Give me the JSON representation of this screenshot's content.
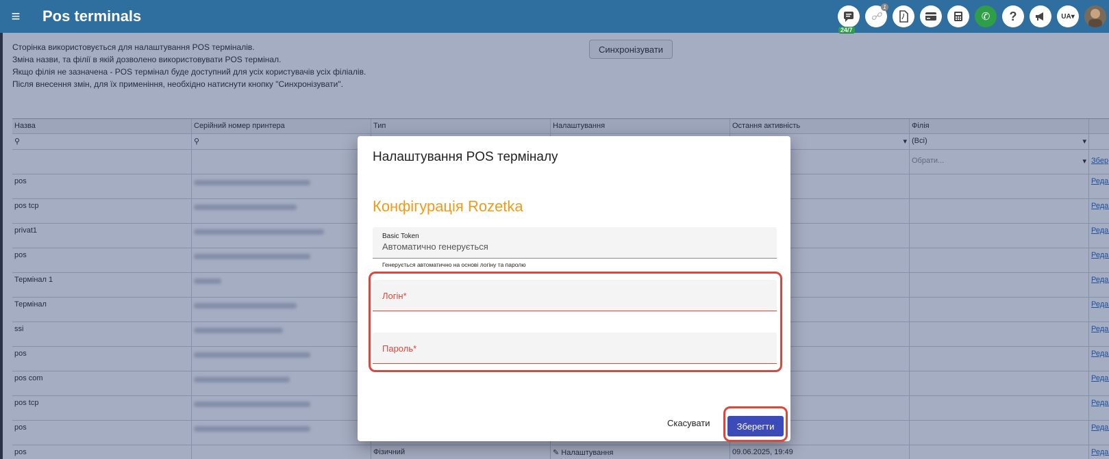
{
  "header": {
    "menu_icon": "hamburger-icon",
    "title": "Pos terminals",
    "support_badge": "24/7",
    "notif_count": "1",
    "lang": "UA▾"
  },
  "info": {
    "lines": [
      "Сторінка використовується для налаштування POS терміналів.",
      "Зміна назви, та філії в якій дозволено використовувати POS термінал.",
      "Якщо філія не зазначена - POS термінал буде доступний для усіх користувачів усіх філіалів.",
      "Після внесення змін, для їх применіння, необхідно натиснути кнопку \"Синхронізувати\"."
    ],
    "sync_button": "Синхронізувати"
  },
  "grid": {
    "columns": [
      "Назва",
      "Серійний номер принтера",
      "Тип",
      "Налаштування",
      "Остання активність",
      "Філія",
      ""
    ],
    "filter_branch": "(Всі)",
    "select_placeholder": "Обрати...",
    "save_link": "Збер",
    "edit_link": "Редаг",
    "rows": [
      {
        "name": "pos"
      },
      {
        "name": "pos tcp"
      },
      {
        "name": "privat1"
      },
      {
        "name": "pos"
      },
      {
        "name": "Термінал 1"
      },
      {
        "name": "Термінал"
      },
      {
        "name": "ssi"
      },
      {
        "name": "pos"
      },
      {
        "name": "pos com"
      },
      {
        "name": "pos tcp"
      },
      {
        "name": "pos"
      },
      {
        "name": "pos"
      }
    ],
    "last_row": {
      "type": "Фізичний",
      "settings": "Налаштування",
      "activity": "09.06.2025, 19:49"
    }
  },
  "modal": {
    "title": "Налаштування POS терміналу",
    "config_title": "Конфігурація Rozetka",
    "token_label": "Basic Token",
    "token_value": "Автоматично генерується",
    "token_hint": "Генерується автоматично на основі логіну та паролю",
    "login_label": "Логін*",
    "password_label": "Пароль*",
    "cancel": "Скасувати",
    "save": "Зберегти"
  }
}
